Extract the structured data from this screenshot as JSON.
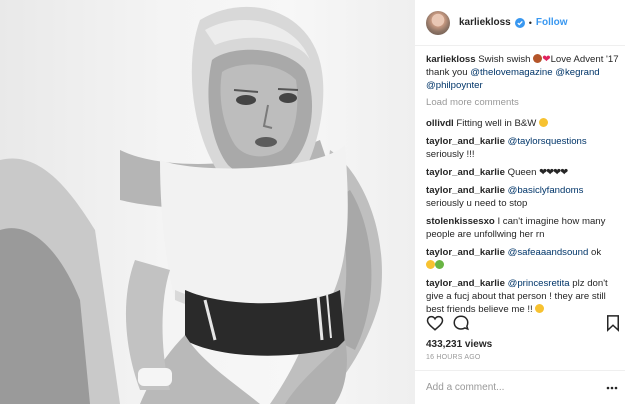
{
  "post": {
    "username": "karliekloss",
    "follow_label": "Follow",
    "header_separator": "•",
    "caption": {
      "user": "karliekloss",
      "text_1": " Swish swish ",
      "emoji_1": "basketball-emoji",
      "emoji_2": "heart-emoji",
      "text_2": "Love Advent '17 thank you ",
      "mention_1": "@thelovemagazine",
      "mention_2": "@kegrand",
      "mention_3": "@philpoynter"
    },
    "load_more_label": "Load more comments",
    "comments": [
      {
        "user": "ollivdl",
        "text": " Fitting well in B&W ",
        "emoji": "smiling-face-emoji"
      },
      {
        "user": "taylor_and_karlie",
        "mention": "@taylorsquestions",
        "text": " seriously !!!"
      },
      {
        "user": "taylor_and_karlie",
        "text": " Queen ",
        "tail": "❤❤❤❤"
      },
      {
        "user": "taylor_and_karlie",
        "mention": "@basiclyfandoms",
        "text": " seriously u need to stop"
      },
      {
        "user": "stolenkissesxo",
        "text": " I can't imagine how many people are unfollwing her rn"
      },
      {
        "user": "taylor_and_karlie",
        "mention": "@safeaaandsound",
        "text": " ok",
        "emoji": "frog-emoji"
      },
      {
        "user": "taylor_and_karlie",
        "mention": "@princesretita",
        "text": " plz don't give a fucj about that person ! they are still best friends believe me !! ",
        "emoji": "smiling-face-emoji"
      }
    ],
    "views": "433,231 views",
    "time_ago": "16 HOURS AGO",
    "add_comment_placeholder": "Add a comment...",
    "icons": [
      "verified-badge-icon",
      "heart-icon",
      "comment-icon",
      "bookmark-icon",
      "more-options-icon"
    ],
    "colors": {
      "link": "#003569",
      "follow": "#3897f0",
      "muted": "#999999",
      "verified": "#3897f0"
    }
  }
}
